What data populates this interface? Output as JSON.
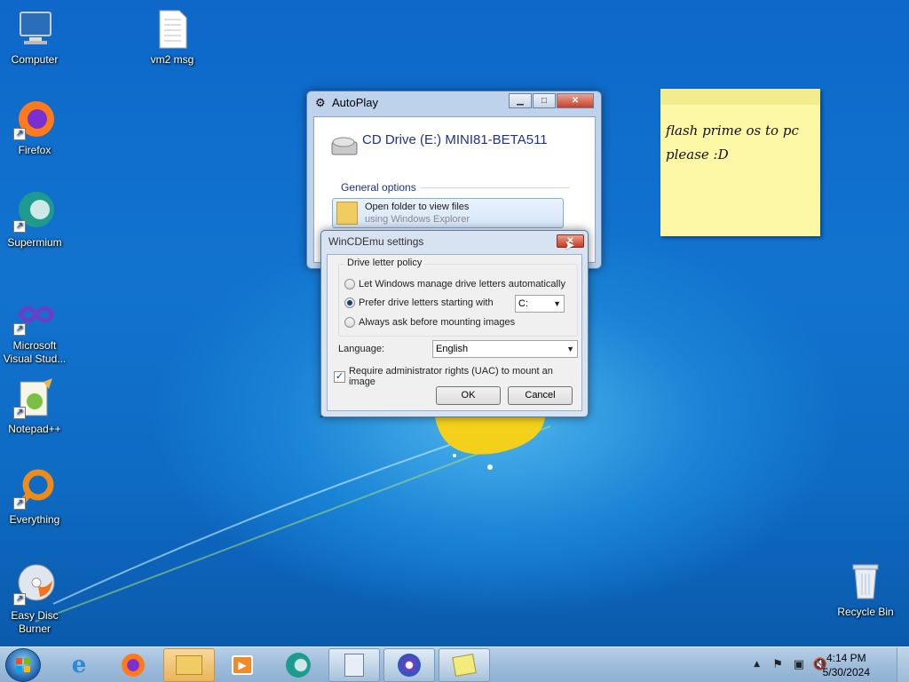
{
  "desktop": {
    "icons": [
      {
        "label": "Computer",
        "icon": "computer-icon"
      },
      {
        "label": "vm2 msg",
        "icon": "text-file-icon"
      },
      {
        "label": "Firefox",
        "icon": "firefox-icon"
      },
      {
        "label": "Supermium",
        "icon": "supermium-icon"
      },
      {
        "label": "Microsoft Visual Stud...",
        "icon": "visual-studio-icon"
      },
      {
        "label": "Notepad++",
        "icon": "notepad-plus-plus-icon"
      },
      {
        "label": "Everything",
        "icon": "everything-search-icon"
      },
      {
        "label": "Easy Disc Burner",
        "icon": "disc-burner-icon"
      },
      {
        "label": "Recycle Bin",
        "icon": "recycle-bin-icon"
      }
    ]
  },
  "sticky_note": {
    "text_line1": "flash prime os to pc",
    "text_line2": "please :D"
  },
  "autoplay": {
    "title": "AutoPlay",
    "drive_title": "CD Drive (E:) MINI81-BETA511",
    "section": "General options",
    "option_title": "Open folder to view files",
    "option_sub": "using Windows Explorer"
  },
  "wincdemu": {
    "title": "WinCDEmu settings",
    "group_label": "Drive letter policy",
    "radio_auto": "Let Windows manage drive letters automatically",
    "radio_prefer": "Prefer drive letters starting with",
    "radio_ask": "Always ask before mounting images",
    "drive_letter": "C:",
    "language_label": "Language:",
    "language_value": "English",
    "uac_label": "Require administrator rights (UAC) to mount an image",
    "uac_checked": true,
    "ok": "OK",
    "cancel": "Cancel"
  },
  "taskbar": {
    "time": "4:14 PM",
    "date": "5/30/2024"
  },
  "colors": {
    "desktop": "#1273cf",
    "taskbar": "#9fbddb",
    "sticky": "#fdf8a5"
  }
}
